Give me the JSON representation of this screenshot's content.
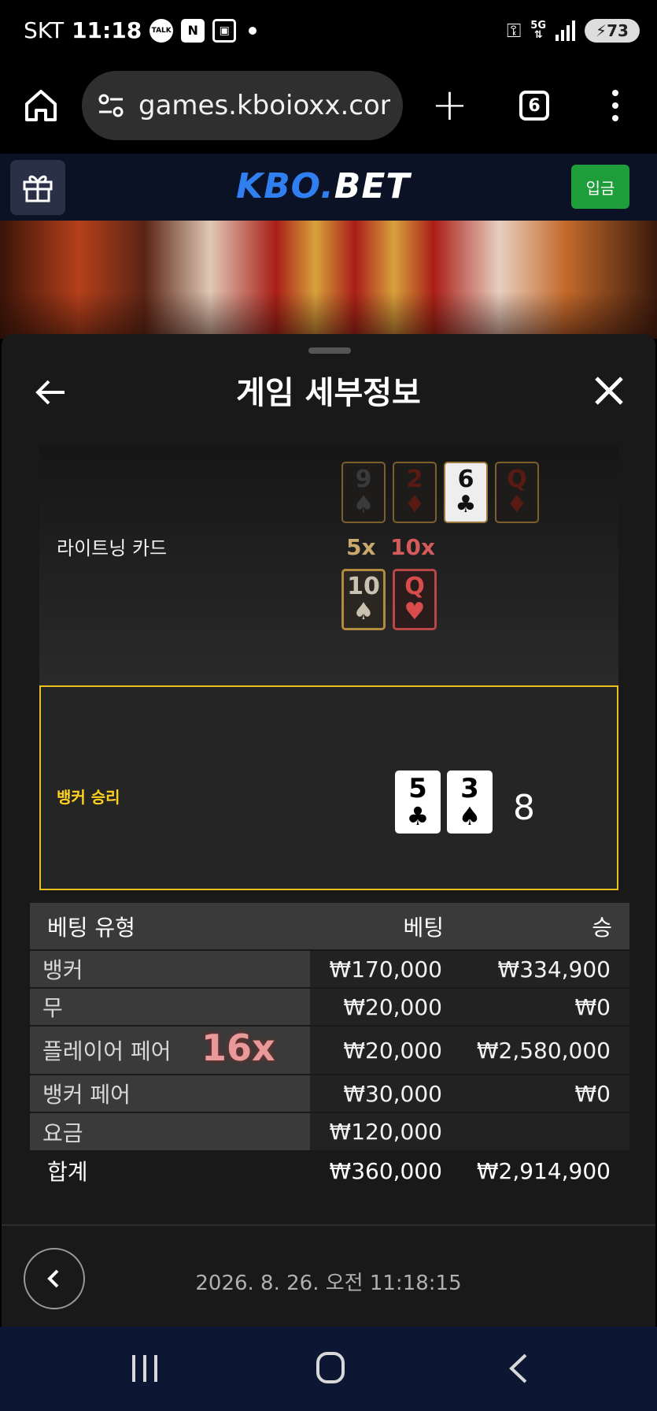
{
  "status_bar": {
    "carrier": "SKT",
    "time": "11:18",
    "battery": "73",
    "network": "5G"
  },
  "browser": {
    "url": "games.kboioxx.com/",
    "tab_count": "6"
  },
  "site_header": {
    "logo_kbo": "KBO.",
    "logo_bet": "BET",
    "deposit_label": "입금"
  },
  "panel": {
    "title": "게임 세부정보",
    "lightning_label": "라이트닝 카드",
    "lightning_cards_top": [
      {
        "rank": "9",
        "suit": "♠"
      },
      {
        "rank": "2",
        "suit": "♦"
      },
      {
        "rank": "6",
        "suit": "♣"
      },
      {
        "rank": "Q",
        "suit": "♦"
      }
    ],
    "multipliers": [
      {
        "label": "5x",
        "card": {
          "rank": "10",
          "suit": "♠"
        }
      },
      {
        "label": "10x",
        "card": {
          "rank": "Q",
          "suit": "♥"
        }
      }
    ],
    "result": {
      "label": "뱅커 승리",
      "cards": [
        {
          "rank": "5",
          "suit": "♣"
        },
        {
          "rank": "3",
          "suit": "♠"
        }
      ],
      "score": "8"
    },
    "table": {
      "headers": {
        "type": "베팅 유형",
        "bet": "베팅",
        "win": "승"
      },
      "rows": [
        {
          "type": "뱅커",
          "bet": "₩170,000",
          "win": "₩334,900"
        },
        {
          "type": "무",
          "bet": "₩20,000",
          "win": "₩0"
        },
        {
          "type": "플레이어 페어",
          "bet": "₩20,000",
          "win": "₩2,580,000",
          "multiplier": "16x"
        },
        {
          "type": "뱅커 페어",
          "bet": "₩30,000",
          "win": "₩0"
        },
        {
          "type": "요금",
          "bet": "₩120,000",
          "win": ""
        }
      ],
      "total": {
        "type": "합계",
        "bet": "₩360,000",
        "win": "₩2,914,900"
      }
    },
    "timestamp": "2026. 8. 26. 오전 11:18:15"
  },
  "colors": {
    "result_border": "#e8c21a",
    "result_label": "#ffd21f",
    "deposit_button": "#1e9e3a",
    "logo_blue": "#2f7ff0"
  }
}
